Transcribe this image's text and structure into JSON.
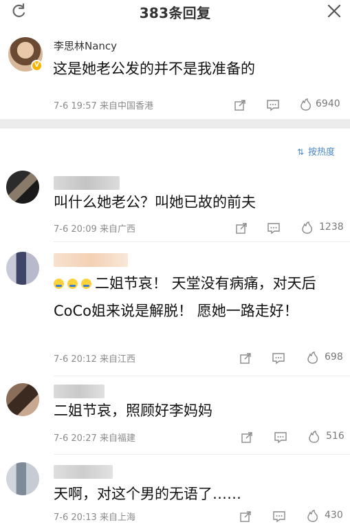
{
  "header": {
    "title": "383条回复",
    "refresh_icon": "refresh-icon",
    "close_icon": "close-icon"
  },
  "post": {
    "author": "李思林Nancy",
    "text": "这是她老公发的并不是我准备的",
    "date": "7-6 19:57 来自中国香港",
    "likes": "6940"
  },
  "sort": {
    "label": "按热度",
    "icon": "sort-icon"
  },
  "comments": [
    {
      "text": "叫什么她老公？叫她已故的前夫",
      "date": "7-6 20:09 来自广西",
      "likes": "1238"
    },
    {
      "emoji_count": 3,
      "text": "二姐节哀！ 天堂没有病痛，对天后CoCo姐来说是解脱！ 愿她一路走好！",
      "date": "7-6 20:12 来自江西",
      "likes": "698"
    },
    {
      "text": "二姐节哀，照顾好李妈妈",
      "date": "7-6 20:27 来自福建",
      "likes": "516"
    },
    {
      "text": "天啊，对这个男的无语了……",
      "date": "7-6 20:13 来自上海",
      "likes": "430"
    }
  ],
  "colors": {
    "accent": "#4a86c8",
    "divider": "#ececec",
    "meta": "#8a8a8a",
    "verified": "#f7b500"
  }
}
